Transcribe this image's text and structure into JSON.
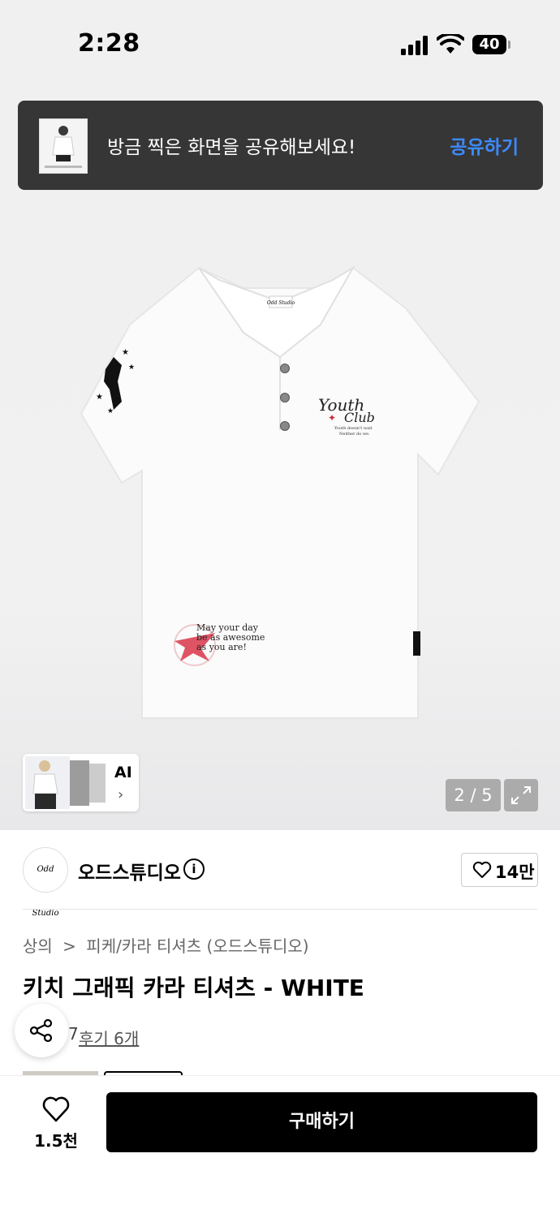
{
  "status_bar": {
    "time": "2:28",
    "battery": "40"
  },
  "toast": {
    "message": "방금 찍은 화면을 공유해보세요!",
    "action_label": "공유하기"
  },
  "product_image": {
    "print_chest": [
      "Youth",
      "Club"
    ],
    "print_chest_small": [
      "Youth doesn't wait",
      "Neither do we."
    ],
    "print_hem": [
      "May your day",
      "be as awesome",
      "as you are!"
    ],
    "neck_label": "Odd Studio"
  },
  "ai_card": {
    "label": "AI",
    "chevron": "›"
  },
  "gallery": {
    "page_indicator": "2 / 5",
    "expand_icon": "expand-icon"
  },
  "brand": {
    "logo_text": "Odd Studio",
    "name": "오드스튜디오",
    "info_icon": "i",
    "like_count": "14만"
  },
  "breadcrumb": {
    "category": "상의",
    "separator": ">",
    "subcategory": "피케/카라 티셔츠 (오드스튜디오)"
  },
  "product": {
    "title": "키치 그래픽 카라 티셔츠 - WHITE",
    "rating_star": "7",
    "review_label": "후기 6개"
  },
  "bottom_bar": {
    "like_count": "1.5천",
    "buy_label": "구매하기"
  },
  "colors": {
    "toast_bg": "#363636",
    "toast_action": "#3d8bff",
    "buy_bg": "#000000"
  }
}
